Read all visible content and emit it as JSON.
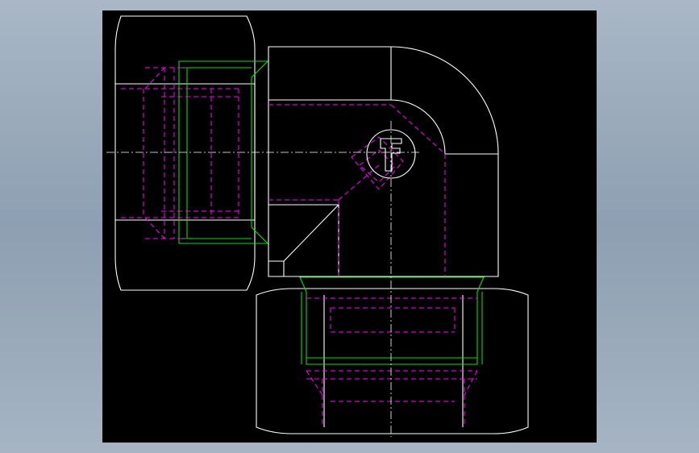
{
  "view": {
    "background": "#000000",
    "frame_background": "#9aabbd"
  },
  "colors": {
    "outline": "#ffffff",
    "thread": "#00e000",
    "hidden": "#ff00ff",
    "centerline": "#ffffff"
  },
  "logo": {
    "icon": "parker-logo-icon"
  }
}
